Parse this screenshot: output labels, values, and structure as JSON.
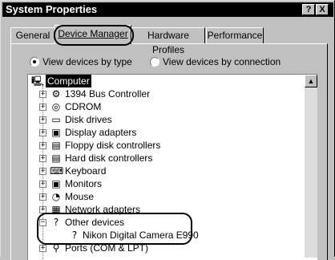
{
  "window": {
    "title": "System Properties",
    "help_btn": "?",
    "close_btn": "X"
  },
  "tabs": [
    {
      "label": "General"
    },
    {
      "label": "Device Manager"
    },
    {
      "label": "Hardware Profiles"
    },
    {
      "label": "Performance"
    }
  ],
  "view_options": {
    "by_type": "View devices by type",
    "by_connection": "View devices by connection"
  },
  "tree": {
    "root": "Computer",
    "items": [
      {
        "label": "1394 Bus Controller",
        "icon": "bus-controller-icon",
        "glyph": "⚙"
      },
      {
        "label": "CDROM",
        "icon": "cdrom-icon",
        "glyph": "◎"
      },
      {
        "label": "Disk drives",
        "icon": "disk-drive-icon",
        "glyph": "▭"
      },
      {
        "label": "Display adapters",
        "icon": "display-adapter-icon",
        "glyph": "▣"
      },
      {
        "label": "Floppy disk controllers",
        "icon": "floppy-controller-icon",
        "glyph": "▤"
      },
      {
        "label": "Hard disk controllers",
        "icon": "hard-disk-controller-icon",
        "glyph": "▤"
      },
      {
        "label": "Keyboard",
        "icon": "keyboard-icon",
        "glyph": "⌨"
      },
      {
        "label": "Monitors",
        "icon": "monitor-icon",
        "glyph": "▣"
      },
      {
        "label": "Mouse",
        "icon": "mouse-icon",
        "glyph": "◔"
      },
      {
        "label": "Network adapters",
        "icon": "network-adapter-icon",
        "glyph": "▦"
      },
      {
        "label": "Other devices",
        "icon": "question-icon",
        "glyph": "?",
        "expanded": true
      },
      {
        "label": "Nikon Digital Camera E990",
        "icon": "unknown-device-icon",
        "glyph": "?",
        "child": true
      },
      {
        "label": "Ports (COM & LPT)",
        "icon": "port-icon",
        "glyph": "⚲"
      }
    ]
  },
  "expander": {
    "collapsed": "+",
    "expanded": "−"
  },
  "scrollbar": {
    "up_arrow": "▲"
  }
}
